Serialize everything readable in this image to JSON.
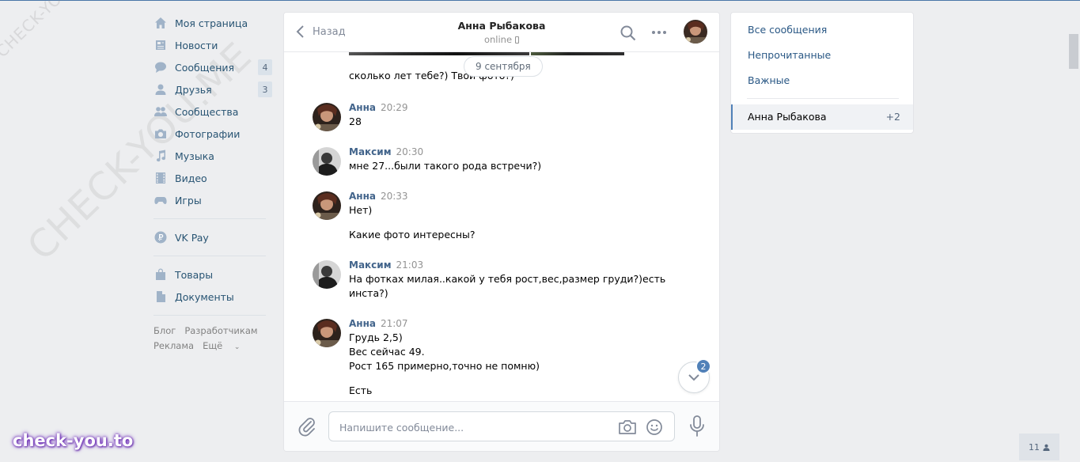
{
  "sidebar": {
    "items": [
      {
        "label": "Моя страница",
        "icon": "home-icon"
      },
      {
        "label": "Новости",
        "icon": "news-icon"
      },
      {
        "label": "Сообщения",
        "icon": "messages-icon",
        "count": "4"
      },
      {
        "label": "Друзья",
        "icon": "friends-icon",
        "count": "3"
      },
      {
        "label": "Сообщества",
        "icon": "communities-icon"
      },
      {
        "label": "Фотографии",
        "icon": "photos-icon"
      },
      {
        "label": "Музыка",
        "icon": "music-icon"
      },
      {
        "label": "Видео",
        "icon": "video-icon"
      },
      {
        "label": "Игры",
        "icon": "games-icon"
      }
    ],
    "vkpay": {
      "label": "VK Pay",
      "icon": "vkpay-icon"
    },
    "extra": [
      {
        "label": "Товары",
        "icon": "goods-icon"
      },
      {
        "label": "Документы",
        "icon": "documents-icon"
      }
    ],
    "footer": {
      "blog": "Блог",
      "developers": "Разработчикам",
      "ads": "Реклама",
      "more": "Ещё"
    }
  },
  "watermark": {
    "small": "CHECK-YOU.ME",
    "large": "CHECK-YOU.ME",
    "brand": "check-you.to"
  },
  "chat": {
    "back_label": "Назад",
    "peer_name": "Анна Рыбакова",
    "peer_status": "online",
    "date_separator": "9 сентября",
    "prev_text": "сколько лет тебе?) Твои фото?)",
    "messages": [
      {
        "author": "Анна",
        "time": "20:29",
        "lines": [
          "28"
        ]
      },
      {
        "author": "Максим",
        "time": "20:30",
        "lines": [
          "мне 27...были такого рода встречи?)"
        ]
      },
      {
        "author": "Анна",
        "time": "20:33",
        "lines": [
          "Нет)",
          "Какие фото интересны?"
        ]
      },
      {
        "author": "Максим",
        "time": "21:03",
        "lines": [
          "На фотках милая..какой у тебя рост,вес,размер груди?)есть",
          "инста?)"
        ]
      },
      {
        "author": "Анна",
        "time": "21:07",
        "lines": [
          "Грудь 2,5)",
          "Вес сейчас 49.",
          "Рост 165 примерно,точно не помню)",
          "Есть"
        ]
      }
    ],
    "unread_badge": "2",
    "composer_placeholder": "Напишите сообщение..."
  },
  "right_panel": {
    "all": "Все сообщения",
    "unread": "Непрочитанные",
    "important": "Важные",
    "active_dialog": {
      "name": "Анна Рыбакова",
      "count": "+2"
    }
  },
  "online_count": "11",
  "colors": {
    "accent": "#5181b8",
    "link": "#2a5885",
    "background": "#edeef0"
  }
}
